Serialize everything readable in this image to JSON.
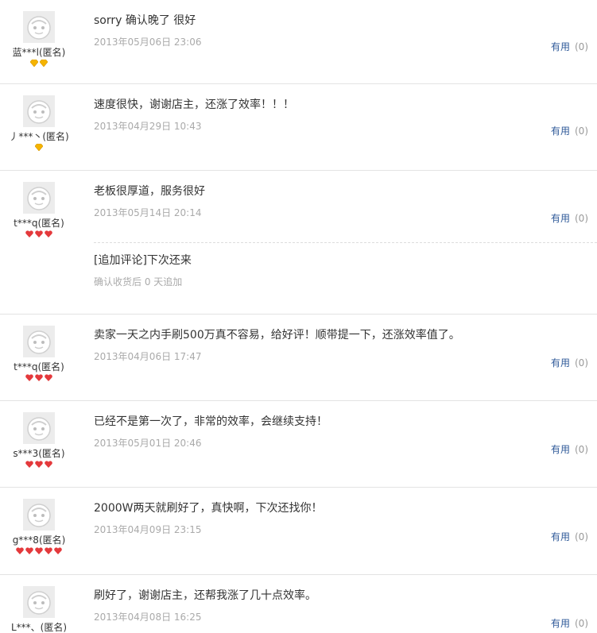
{
  "reviews": [
    {
      "username": "蓝***l(匿名)",
      "badge_type": "yellow",
      "badge_count": 2,
      "comment": "sorry 确认晚了 很好",
      "date": "2013年05月06日 23:06",
      "helpful_label": "有用",
      "helpful_count": "(0)"
    },
    {
      "username": "丿***丶(匿名)",
      "badge_type": "yellow",
      "badge_count": 1,
      "comment": "速度很快，谢谢店主，还涨了效率！！！",
      "date": "2013年04月29日 10:43",
      "helpful_label": "有用",
      "helpful_count": "(0)"
    },
    {
      "username": "t***q(匿名)",
      "badge_type": "red",
      "badge_count": 3,
      "comment": "老板很厚道，服务很好",
      "date": "2013年05月14日 20:14",
      "helpful_label": "有用",
      "helpful_count": "(0)",
      "append": {
        "text": "[追加评论]下次还来",
        "note": "确认收货后 0 天追加"
      }
    },
    {
      "username": "t***q(匿名)",
      "badge_type": "red",
      "badge_count": 3,
      "comment": "卖家一天之内手刷500万真不容易，给好评！顺带提一下，还涨效率值了。",
      "date": "2013年04月06日 17:47",
      "helpful_label": "有用",
      "helpful_count": "(0)"
    },
    {
      "username": "s***3(匿名)",
      "badge_type": "red",
      "badge_count": 3,
      "comment": "已经不是第一次了，非常的效率，会继续支持！",
      "date": "2013年05月01日 20:46",
      "helpful_label": "有用",
      "helpful_count": "(0)"
    },
    {
      "username": "g***8(匿名)",
      "badge_type": "red",
      "badge_count": 5,
      "comment": "2000W两天就刷好了，真快啊，下次还找你！",
      "date": "2013年04月09日 23:15",
      "helpful_label": "有用",
      "helpful_count": "(0)"
    },
    {
      "username": "L***、(匿名)",
      "badge_type": "red",
      "badge_count": 0,
      "comment": "刷好了，谢谢店主，还帮我涨了几十点效率。",
      "date": "2013年04月08日 16:25",
      "helpful_label": "有用",
      "helpful_count": "(0)"
    }
  ],
  "colors": {
    "badge_yellow": "#f5b400",
    "badge_red": "#e4393c",
    "link": "#2f5a99",
    "date": "#aaaaaa"
  }
}
